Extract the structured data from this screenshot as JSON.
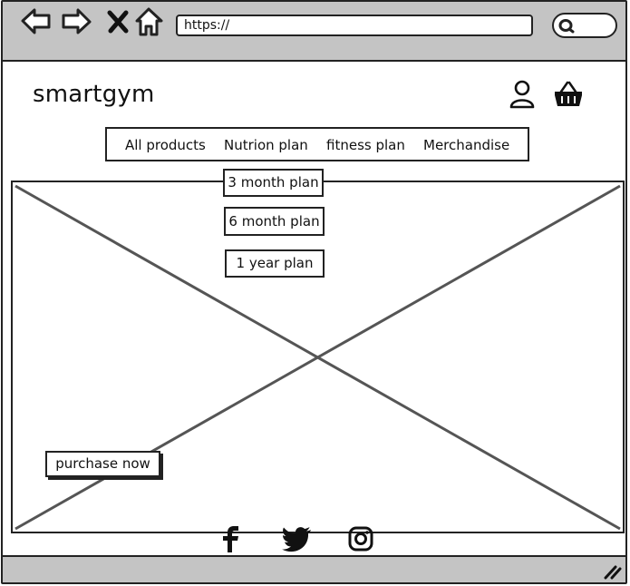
{
  "browser": {
    "url": "https://",
    "icons": [
      "back-arrow-icon",
      "forward-arrow-icon",
      "close-icon",
      "home-icon",
      "search-icon"
    ]
  },
  "header": {
    "brand": "smartgym",
    "icons": [
      "user-icon",
      "basket-icon"
    ]
  },
  "nav": {
    "items": [
      "All products",
      "Nutrion plan",
      "fitness plan",
      "Merchandise"
    ]
  },
  "dropdown": {
    "items": [
      "3 month plan",
      "6 month plan",
      "1 year plan"
    ]
  },
  "hero": {
    "cta": "purchase now"
  },
  "footer": {
    "icons": [
      "facebook-icon",
      "twitter-icon",
      "instagram-icon"
    ]
  }
}
